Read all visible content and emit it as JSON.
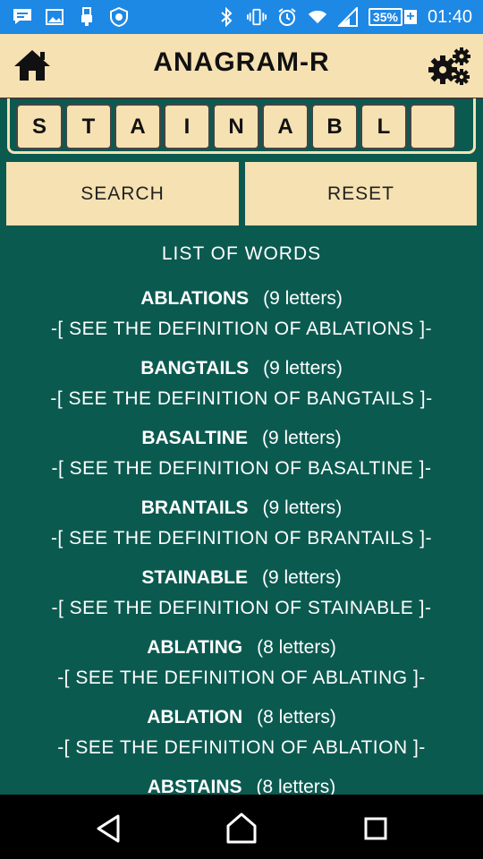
{
  "status_bar": {
    "battery": "35%",
    "time": "01:40",
    "icons_left": [
      "chat-notification-icon",
      "image-icon",
      "usb-icon",
      "app-shield-icon"
    ],
    "icons_right": [
      "bluetooth-icon",
      "vibrate-icon",
      "alarm-icon",
      "wifi-icon",
      "signal-icon",
      "battery-icon"
    ]
  },
  "app_bar": {
    "title": "ANAGRAM-R",
    "home_icon": "home-icon",
    "settings_icon": "gears-icon"
  },
  "tiles": [
    "S",
    "T",
    "A",
    "I",
    "N",
    "A",
    "B",
    "L",
    ""
  ],
  "buttons": {
    "search": "SEARCH",
    "reset": "RESET"
  },
  "list_title": "LIST OF WORDS",
  "entries": [
    {
      "word": "ABLATIONS",
      "count": "(9 letters)",
      "link": "-[ SEE THE DEFINITION OF ABLATIONS ]-"
    },
    {
      "word": "BANGTAILS",
      "count": "(9 letters)",
      "link": "-[ SEE THE DEFINITION OF BANGTAILS ]-"
    },
    {
      "word": "BASALTINE",
      "count": "(9 letters)",
      "link": "-[ SEE THE DEFINITION OF BASALTINE ]-"
    },
    {
      "word": "BRANTAILS",
      "count": "(9 letters)",
      "link": "-[ SEE THE DEFINITION OF BRANTAILS ]-"
    },
    {
      "word": "STAINABLE",
      "count": "(9 letters)",
      "link": "-[ SEE THE DEFINITION OF STAINABLE ]-"
    },
    {
      "word": "ABLATING",
      "count": "(8 letters)",
      "link": "-[ SEE THE DEFINITION OF ABLATING ]-"
    },
    {
      "word": "ABLATION",
      "count": "(8 letters)",
      "link": "-[ SEE THE DEFINITION OF ABLATION ]-"
    },
    {
      "word": "ABSTAINS",
      "count": "(8 letters)",
      "link": ""
    }
  ],
  "nav": {
    "back": "back-icon",
    "home": "home-icon",
    "recents": "recents-icon"
  },
  "colors": {
    "status_bar": "#1e88e5",
    "app_bar": "#f6e1b2",
    "background": "#0b5a50",
    "text": "#ffffff"
  }
}
